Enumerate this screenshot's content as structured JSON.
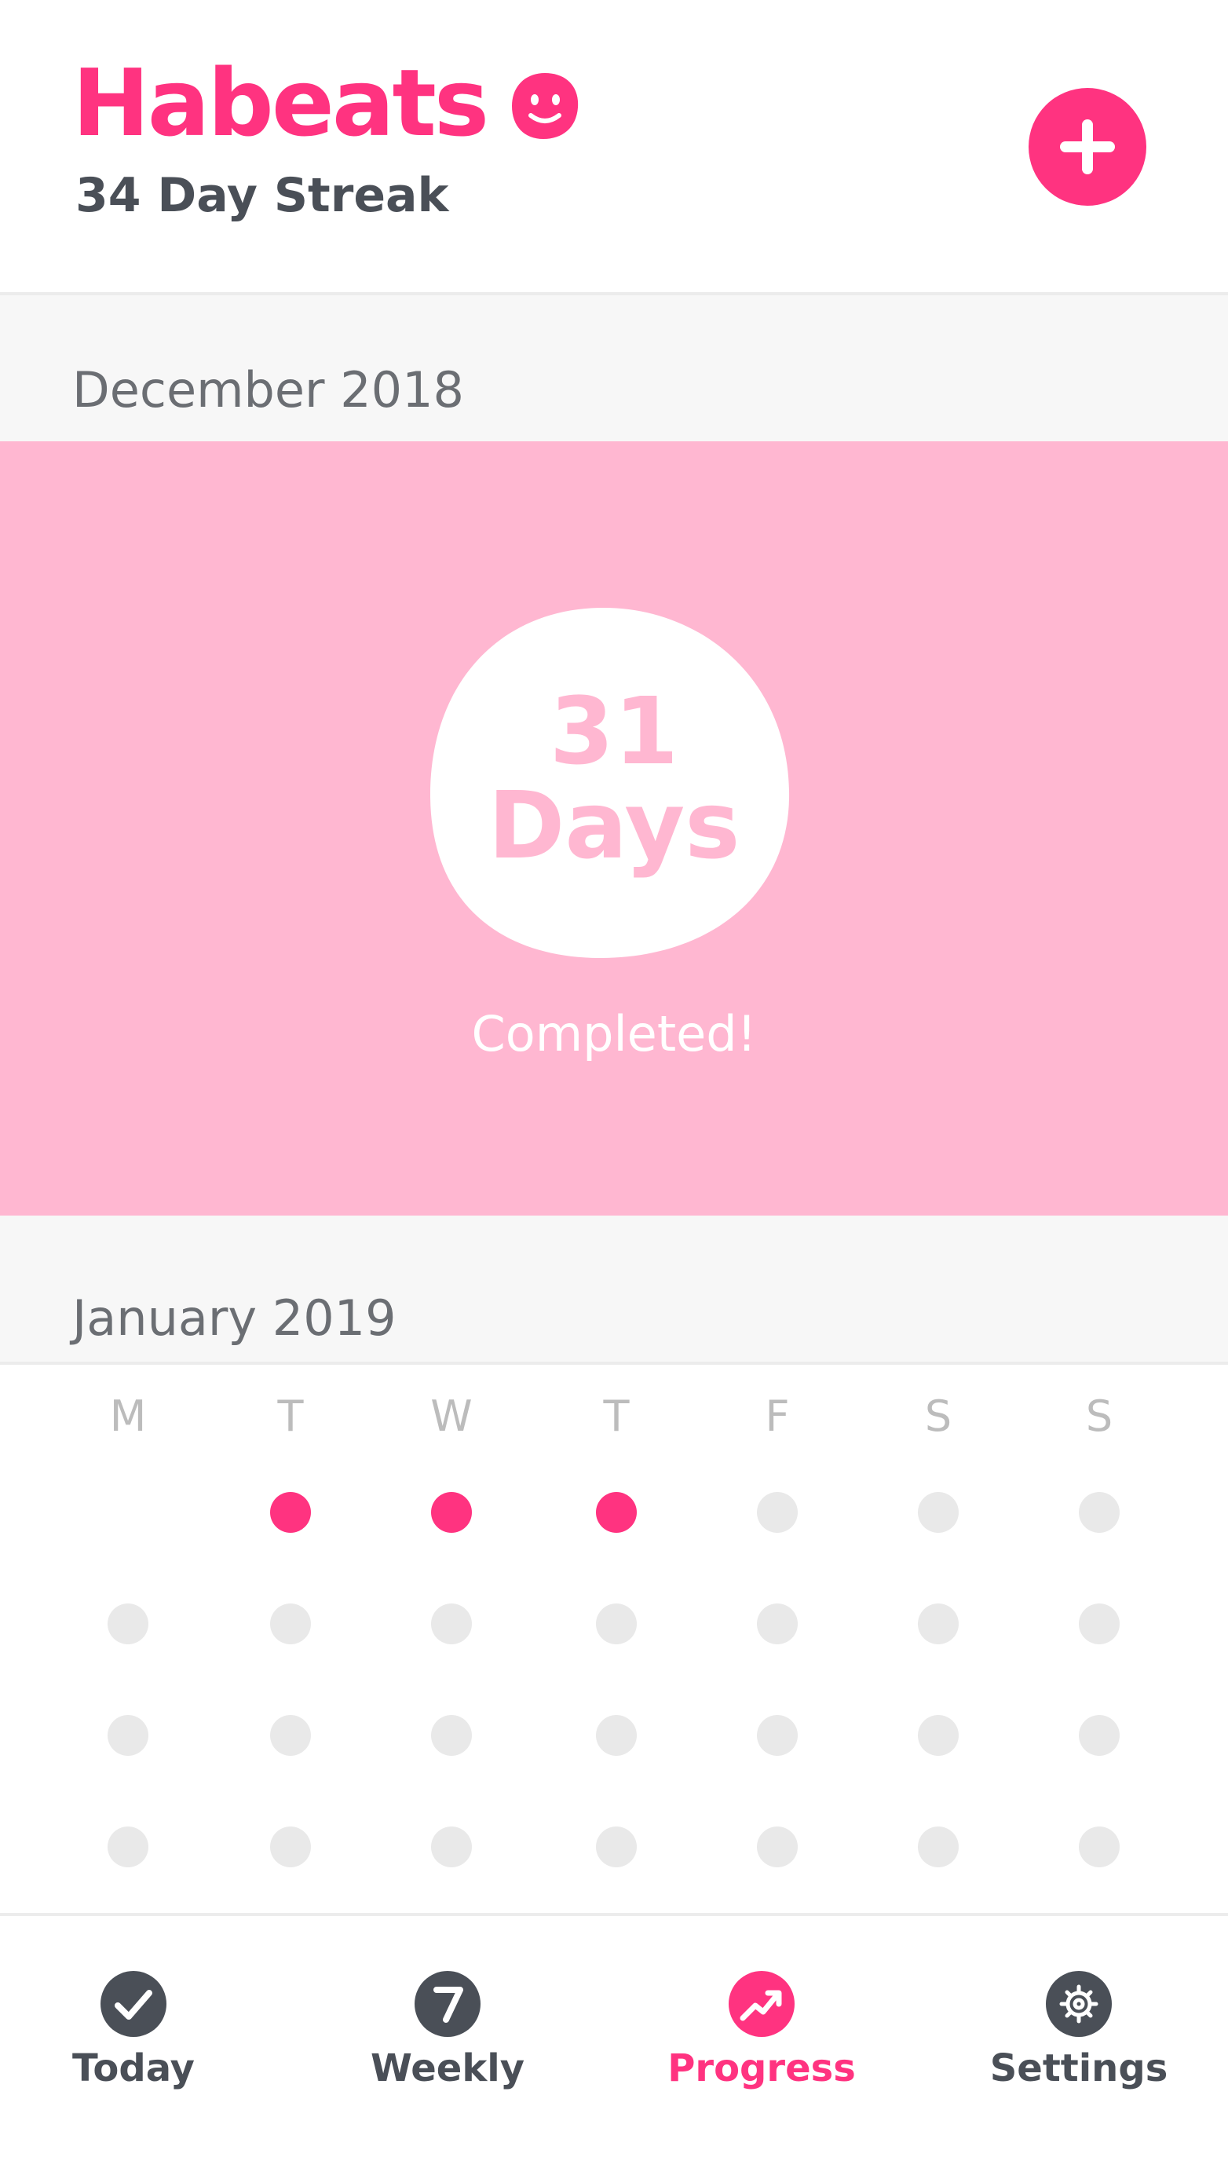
{
  "header": {
    "app_title": "Habeats",
    "streak": "34 Day Streak",
    "add_icon": "plus-icon"
  },
  "months": [
    {
      "label": "December 2018",
      "summary": {
        "count": "31",
        "unit": "Days",
        "status": "Completed!"
      }
    },
    {
      "label": "January 2019"
    }
  ],
  "calendar": {
    "weekdays": [
      "M",
      "T",
      "W",
      "T",
      "F",
      "S",
      "S"
    ],
    "completed_days": [
      1,
      2,
      3
    ],
    "total_visible_days": 27
  },
  "tabs": [
    {
      "label": "Today",
      "icon": "check-icon",
      "active": false
    },
    {
      "label": "Weekly",
      "icon": "seven-icon",
      "active": false
    },
    {
      "label": "Progress",
      "icon": "trending-up-icon",
      "active": true
    },
    {
      "label": "Settings",
      "icon": "gear-icon",
      "active": false
    }
  ],
  "colors": {
    "accent": "#ff3380",
    "panel": "#ffb7d1",
    "dot_empty": "#e9e9e9",
    "text": "#4a4f57"
  }
}
